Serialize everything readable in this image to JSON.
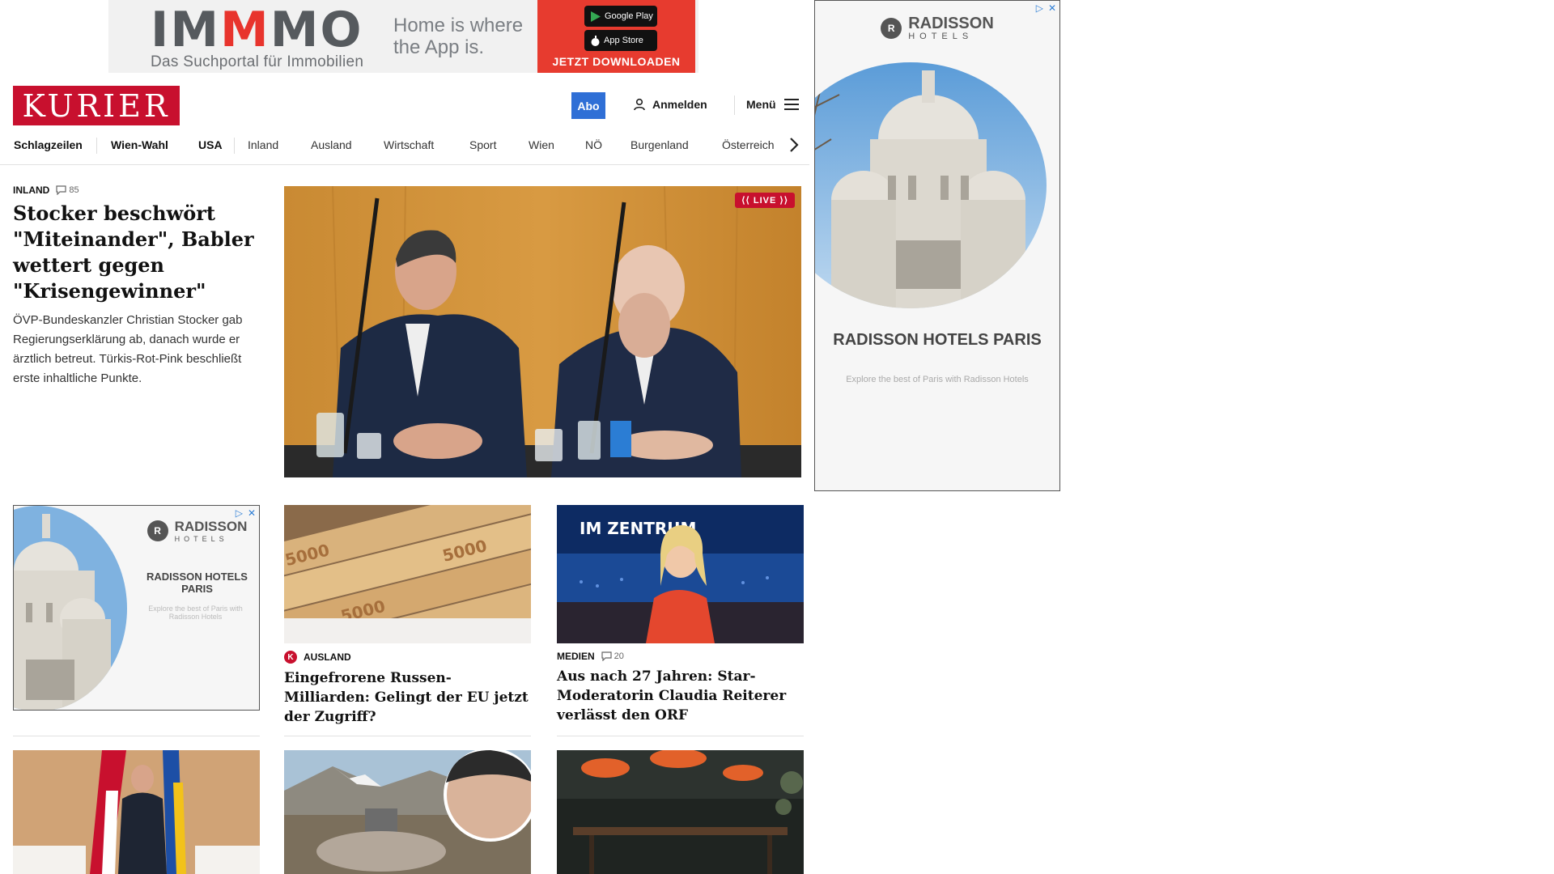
{
  "top_ad": {
    "brand": "IMMMO",
    "brand_sub": "Das Suchportal für Immobilien",
    "slogan_line1": "Home is where",
    "slogan_line2": "the App is.",
    "google_play": "Google Play",
    "app_store": "App Store",
    "cta": "JETZT DOWNLOADEN"
  },
  "header": {
    "logo": "KURIER",
    "abo": "Abo",
    "login": "Anmelden",
    "menu": "Menü"
  },
  "nav": {
    "items": [
      "Schlagzeilen",
      "Wien-Wahl",
      "USA",
      "Inland",
      "Ausland",
      "Wirtschaft",
      "Sport",
      "Wien",
      "NÖ",
      "Burgenland",
      "Österreich"
    ]
  },
  "lead": {
    "kicker": "INLAND",
    "comments": "85",
    "title": "Stocker beschwört \"Miteinander\", Babler wettert gegen \"Krisengewinner\"",
    "teaser": "ÖVP-Bundeskanzler Christian Stocker gab Regierungserklärung ab, danach wurde er ärztlich betreut. Türkis-Rot-Pink beschließt erste inhaltliche Punkte.",
    "live": "LIVE"
  },
  "side_ad": {
    "brand": "RADISSON",
    "brand_sub": "HOTELS",
    "headline": "RADISSON HOTELS PARIS",
    "text": "Explore the best of Paris with Radisson Hotels"
  },
  "cards": [
    {
      "kicker": "AUSLAND",
      "badge": "K",
      "comments": "",
      "title": "Eingefrorene Russen-Milliarden: Gelingt der EU jetzt der Zugriff?"
    },
    {
      "kicker": "MEDIEN",
      "comments": "20",
      "title": "Aus nach 27 Jahren: Star-Moderatorin Claudia Reiterer verlässt den ORF",
      "image_text": "IM ZENTRUM"
    }
  ],
  "colors": {
    "brand_red": "#c8102e",
    "abo_blue": "#2f6fd6",
    "ad_red": "#e73b2f"
  }
}
